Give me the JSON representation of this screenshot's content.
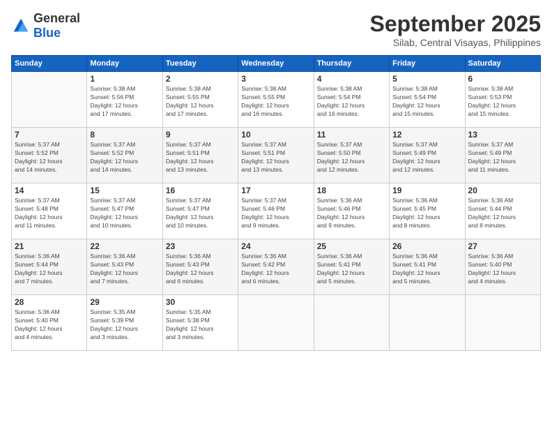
{
  "header": {
    "logo_general": "General",
    "logo_blue": "Blue",
    "month": "September 2025",
    "location": "Silab, Central Visayas, Philippines"
  },
  "weekdays": [
    "Sunday",
    "Monday",
    "Tuesday",
    "Wednesday",
    "Thursday",
    "Friday",
    "Saturday"
  ],
  "weeks": [
    [
      {
        "day": "",
        "info": ""
      },
      {
        "day": "1",
        "info": "Sunrise: 5:38 AM\nSunset: 5:56 PM\nDaylight: 12 hours\nand 17 minutes."
      },
      {
        "day": "2",
        "info": "Sunrise: 5:38 AM\nSunset: 5:55 PM\nDaylight: 12 hours\nand 17 minutes."
      },
      {
        "day": "3",
        "info": "Sunrise: 5:38 AM\nSunset: 5:55 PM\nDaylight: 12 hours\nand 16 minutes."
      },
      {
        "day": "4",
        "info": "Sunrise: 5:38 AM\nSunset: 5:54 PM\nDaylight: 12 hours\nand 16 minutes."
      },
      {
        "day": "5",
        "info": "Sunrise: 5:38 AM\nSunset: 5:54 PM\nDaylight: 12 hours\nand 15 minutes."
      },
      {
        "day": "6",
        "info": "Sunrise: 5:38 AM\nSunset: 5:53 PM\nDaylight: 12 hours\nand 15 minutes."
      }
    ],
    [
      {
        "day": "7",
        "info": "Sunrise: 5:37 AM\nSunset: 5:52 PM\nDaylight: 12 hours\nand 14 minutes."
      },
      {
        "day": "8",
        "info": "Sunrise: 5:37 AM\nSunset: 5:52 PM\nDaylight: 12 hours\nand 14 minutes."
      },
      {
        "day": "9",
        "info": "Sunrise: 5:37 AM\nSunset: 5:51 PM\nDaylight: 12 hours\nand 13 minutes."
      },
      {
        "day": "10",
        "info": "Sunrise: 5:37 AM\nSunset: 5:51 PM\nDaylight: 12 hours\nand 13 minutes."
      },
      {
        "day": "11",
        "info": "Sunrise: 5:37 AM\nSunset: 5:50 PM\nDaylight: 12 hours\nand 12 minutes."
      },
      {
        "day": "12",
        "info": "Sunrise: 5:37 AM\nSunset: 5:49 PM\nDaylight: 12 hours\nand 12 minutes."
      },
      {
        "day": "13",
        "info": "Sunrise: 5:37 AM\nSunset: 5:49 PM\nDaylight: 12 hours\nand 11 minutes."
      }
    ],
    [
      {
        "day": "14",
        "info": "Sunrise: 5:37 AM\nSunset: 5:48 PM\nDaylight: 12 hours\nand 11 minutes."
      },
      {
        "day": "15",
        "info": "Sunrise: 5:37 AM\nSunset: 5:47 PM\nDaylight: 12 hours\nand 10 minutes."
      },
      {
        "day": "16",
        "info": "Sunrise: 5:37 AM\nSunset: 5:47 PM\nDaylight: 12 hours\nand 10 minutes."
      },
      {
        "day": "17",
        "info": "Sunrise: 5:37 AM\nSunset: 5:46 PM\nDaylight: 12 hours\nand 9 minutes."
      },
      {
        "day": "18",
        "info": "Sunrise: 5:36 AM\nSunset: 5:46 PM\nDaylight: 12 hours\nand 9 minutes."
      },
      {
        "day": "19",
        "info": "Sunrise: 5:36 AM\nSunset: 5:45 PM\nDaylight: 12 hours\nand 8 minutes."
      },
      {
        "day": "20",
        "info": "Sunrise: 5:36 AM\nSunset: 5:44 PM\nDaylight: 12 hours\nand 8 minutes."
      }
    ],
    [
      {
        "day": "21",
        "info": "Sunrise: 5:36 AM\nSunset: 5:44 PM\nDaylight: 12 hours\nand 7 minutes."
      },
      {
        "day": "22",
        "info": "Sunrise: 5:36 AM\nSunset: 5:43 PM\nDaylight: 12 hours\nand 7 minutes."
      },
      {
        "day": "23",
        "info": "Sunrise: 5:36 AM\nSunset: 5:43 PM\nDaylight: 12 hours\nand 6 minutes."
      },
      {
        "day": "24",
        "info": "Sunrise: 5:36 AM\nSunset: 5:42 PM\nDaylight: 12 hours\nand 6 minutes."
      },
      {
        "day": "25",
        "info": "Sunrise: 5:36 AM\nSunset: 5:41 PM\nDaylight: 12 hours\nand 5 minutes."
      },
      {
        "day": "26",
        "info": "Sunrise: 5:36 AM\nSunset: 5:41 PM\nDaylight: 12 hours\nand 5 minutes."
      },
      {
        "day": "27",
        "info": "Sunrise: 5:36 AM\nSunset: 5:40 PM\nDaylight: 12 hours\nand 4 minutes."
      }
    ],
    [
      {
        "day": "28",
        "info": "Sunrise: 5:36 AM\nSunset: 5:40 PM\nDaylight: 12 hours\nand 4 minutes."
      },
      {
        "day": "29",
        "info": "Sunrise: 5:35 AM\nSunset: 5:39 PM\nDaylight: 12 hours\nand 3 minutes."
      },
      {
        "day": "30",
        "info": "Sunrise: 5:35 AM\nSunset: 5:38 PM\nDaylight: 12 hours\nand 3 minutes."
      },
      {
        "day": "",
        "info": ""
      },
      {
        "day": "",
        "info": ""
      },
      {
        "day": "",
        "info": ""
      },
      {
        "day": "",
        "info": ""
      }
    ]
  ]
}
